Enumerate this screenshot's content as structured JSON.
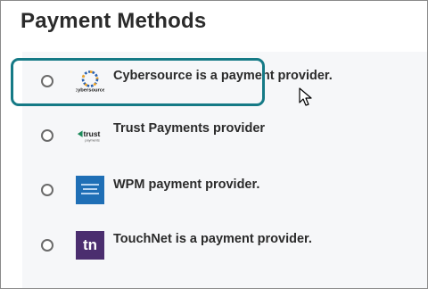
{
  "page": {
    "title": "Payment Methods"
  },
  "payment_methods": [
    {
      "label": "Cybersource is a payment provider.",
      "logo": "cybersource-logo",
      "logo_text": "cybersource",
      "selected": false
    },
    {
      "label": "Trust Payments provider",
      "logo": "trust-payments-logo",
      "logo_text": "trust",
      "logo_subtext": "payments",
      "selected": true
    },
    {
      "label": "WPM payment provider.",
      "logo": "wpm-logo",
      "selected": false
    },
    {
      "label": "TouchNet is a payment provider.",
      "logo": "touchnet-logo",
      "logo_text": "tn",
      "selected": false
    }
  ],
  "colors": {
    "accent": "#157a86",
    "panel_bg": "#f6f7f9",
    "text": "#2b2b2b",
    "touchnet_bg": "#4b2e6f",
    "wpm_bg": "#1f6fb6"
  }
}
